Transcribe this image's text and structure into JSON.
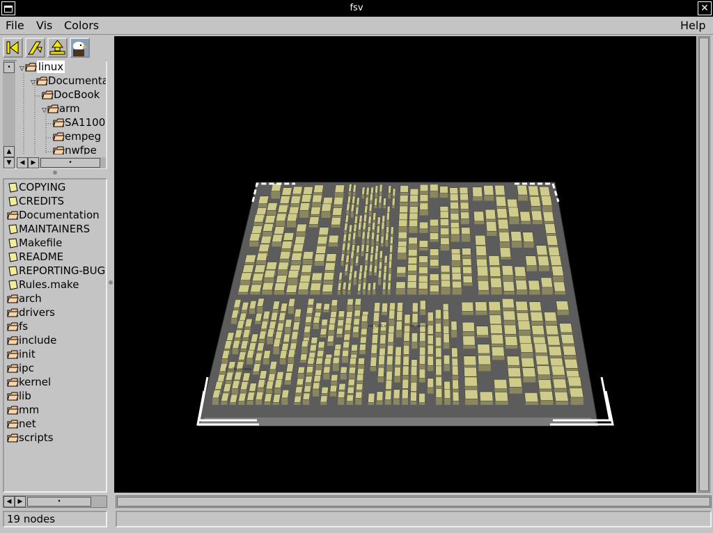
{
  "window": {
    "title": "fsv",
    "menu_icon": "window-menu-icon",
    "close_icon": "close-icon",
    "close_glyph": "✕"
  },
  "menubar": {
    "file": "File",
    "vis": "Vis",
    "colors": "Colors",
    "help": "Help"
  },
  "toolbar": {
    "buttons": [
      {
        "icon": "back-to-root-icon"
      },
      {
        "icon": "cd-up-icon"
      },
      {
        "icon": "bird-eye-view-icon"
      },
      {
        "icon": "eagle-icon"
      }
    ]
  },
  "tree": {
    "items": [
      {
        "label": "linux",
        "level": 0,
        "expanded": true,
        "selected": true
      },
      {
        "label": "Documentation",
        "level": 1,
        "expanded": true
      },
      {
        "label": "DocBook",
        "level": 2
      },
      {
        "label": "arm",
        "level": 2,
        "expanded": true
      },
      {
        "label": "SA1100",
        "level": 3
      },
      {
        "label": "empeg",
        "level": 3
      },
      {
        "label": "nwfpe",
        "level": 3
      }
    ]
  },
  "list": {
    "items": [
      {
        "label": "COPYING",
        "kind": "file"
      },
      {
        "label": "CREDITS",
        "kind": "file"
      },
      {
        "label": "Documentation",
        "kind": "folder"
      },
      {
        "label": "MAINTAINERS",
        "kind": "file"
      },
      {
        "label": "Makefile",
        "kind": "file"
      },
      {
        "label": "README",
        "kind": "file"
      },
      {
        "label": "REPORTING-BUGS",
        "kind": "file"
      },
      {
        "label": "Rules.make",
        "kind": "file"
      },
      {
        "label": "arch",
        "kind": "folder"
      },
      {
        "label": "drivers",
        "kind": "folder"
      },
      {
        "label": "fs",
        "kind": "folder"
      },
      {
        "label": "include",
        "kind": "folder"
      },
      {
        "label": "init",
        "kind": "folder"
      },
      {
        "label": "ipc",
        "kind": "folder"
      },
      {
        "label": "kernel",
        "kind": "folder"
      },
      {
        "label": "lib",
        "kind": "folder"
      },
      {
        "label": "mm",
        "kind": "folder"
      },
      {
        "label": "net",
        "kind": "folder"
      },
      {
        "label": "scripts",
        "kind": "folder"
      }
    ]
  },
  "visualization": {
    "labels": [
      "Configure.help",
      "sis_sp01.c",
      "sis_sp04.c"
    ]
  },
  "status": {
    "nodes": "19 nodes"
  },
  "colors": {
    "file_fill": "#f0ec9a",
    "folder_fill": "#f3c08e",
    "block": "#cfcb8a",
    "platform": "#6b6b6b"
  }
}
